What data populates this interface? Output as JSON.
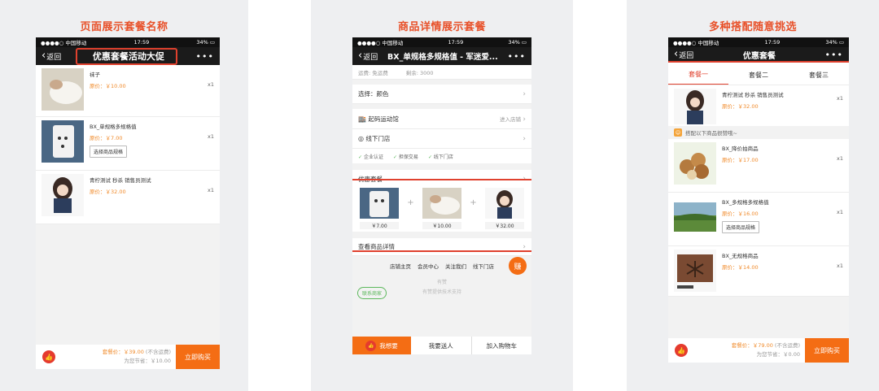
{
  "colors": {
    "accent": "#e0412e",
    "orange": "#f46d14",
    "caption": "#e8512a"
  },
  "status": {
    "carrier": "●●●●○ 中国移动",
    "time": "17:59",
    "battery": "34%"
  },
  "panel1": {
    "caption": "页面展示套餐名称",
    "back": "返回",
    "title": "优惠套餐活动大促",
    "more": "•••",
    "items": [
      {
        "name": "袜子",
        "price": "原价：￥10.00",
        "qty": "x1"
      },
      {
        "name": "BX_单规格多规格值",
        "price": "原价：￥7.00",
        "qty": "x1",
        "spec": "选择商品规格"
      },
      {
        "name": "青柠测试 秒杀 销售员测试",
        "price": "原价：￥32.00",
        "qty": "x1"
      }
    ],
    "set_price": "套餐价：￥39.00",
    "set_price_note": "(不含运费)",
    "save": "为您节省：￥10.00",
    "buy": "立即购买"
  },
  "panel2": {
    "caption": "商品详情展示套餐",
    "back": "返回",
    "title": "BX_单规格多规格值 - 军迷爱...",
    "more": "•••",
    "shipping": "运费: 免运费",
    "stock": "剩余: 3000",
    "choose": "选择：颜色",
    "shop": "起码运动馆",
    "enter_shop": "进入店铺",
    "offline": "线下门店",
    "badges": [
      "企业认证",
      "担保交易",
      "线下门店"
    ],
    "combo_title": "优惠套餐",
    "combo_prices": [
      "￥7.00",
      "￥10.00",
      "￥32.00"
    ],
    "plus": "+",
    "details": "查看商品详情",
    "links": [
      "店铺主页",
      "会员中心",
      "关注我们",
      "线下门店"
    ],
    "earn": "赚",
    "contact": "联系商家",
    "youzan": "有赞",
    "support": "有赞提供技术支持",
    "want": "我想要",
    "gift": "我要送人",
    "cart": "加入购物车"
  },
  "panel3": {
    "caption": "多种搭配随意挑选",
    "back": "返回",
    "title": "优惠套餐",
    "more": "•••",
    "tabs": [
      "套餐一",
      "套餐二",
      "套餐三"
    ],
    "main_item": {
      "name": "青柠测试 秒杀 销售员测试",
      "price": "原价：￥32.00",
      "qty": "x1"
    },
    "pair_hint": "搭配以下商品很赞哦~",
    "items": [
      {
        "name": "BX_降价拍商品",
        "price": "原价：￥17.00",
        "qty": "x1"
      },
      {
        "name": "BX_多规格多规格值",
        "price": "原价：￥16.00",
        "qty": "x1",
        "spec": "选择商品规格"
      },
      {
        "name": "BX_无规格商品",
        "price": "原价：￥14.00",
        "qty": "x1"
      }
    ],
    "set_price": "套餐价：￥79.00",
    "set_price_note": "(不含运费)",
    "save": "为您节省：￥0.00",
    "buy": "立即购买"
  }
}
